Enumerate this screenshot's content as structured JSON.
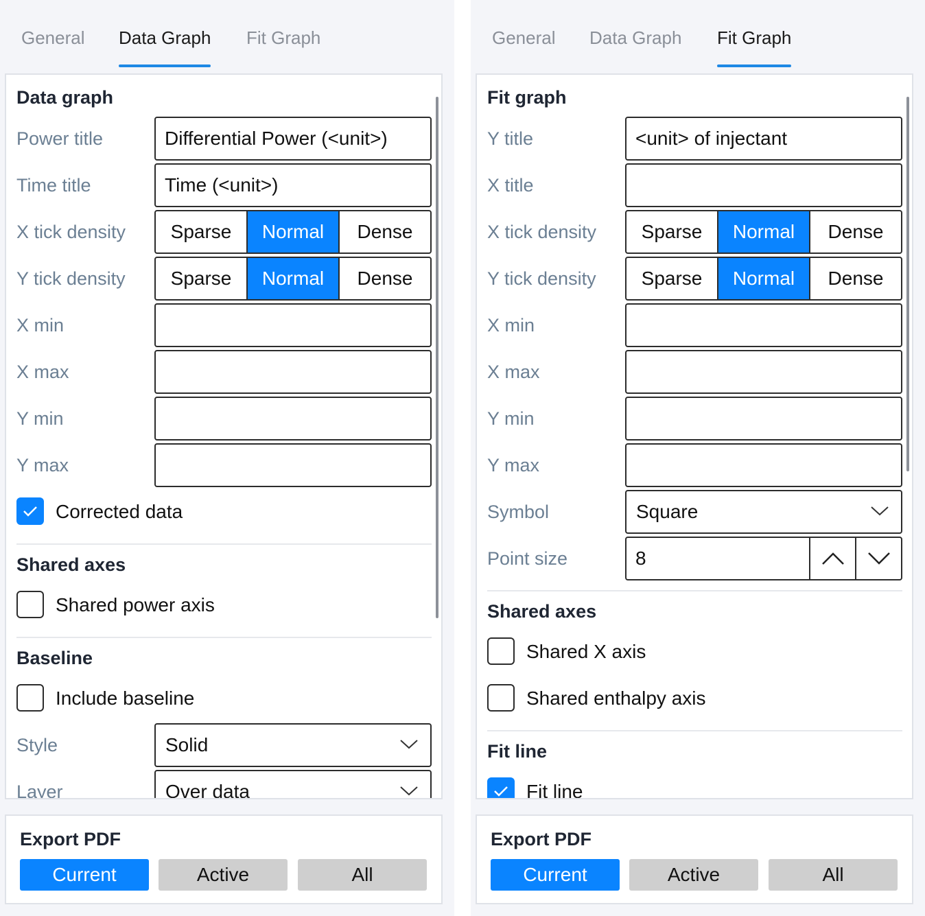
{
  "accent_color": "#0a84ff",
  "left": {
    "tabs": [
      {
        "label": "General"
      },
      {
        "label": "Data Graph"
      },
      {
        "label": "Fit Graph"
      }
    ],
    "active_tab": "Data Graph",
    "section_title": "Data graph",
    "power_title": {
      "label": "Power title",
      "value": "Differential Power (<unit>)"
    },
    "time_title": {
      "label": "Time title",
      "value": "Time (<unit>)"
    },
    "x_tick": {
      "label": "X tick density",
      "options": [
        "Sparse",
        "Normal",
        "Dense"
      ],
      "selected": "Normal"
    },
    "y_tick": {
      "label": "Y tick density",
      "options": [
        "Sparse",
        "Normal",
        "Dense"
      ],
      "selected": "Normal"
    },
    "x_min": {
      "label": "X min",
      "value": ""
    },
    "x_max": {
      "label": "X max",
      "value": ""
    },
    "y_min": {
      "label": "Y min",
      "value": ""
    },
    "y_max": {
      "label": "Y max",
      "value": ""
    },
    "corrected": {
      "label": "Corrected data",
      "checked": true
    },
    "shared_axes": {
      "title": "Shared axes",
      "power_axis": {
        "label": "Shared power axis",
        "checked": false
      }
    },
    "baseline": {
      "title": "Baseline",
      "include": {
        "label": "Include baseline",
        "checked": false
      },
      "style": {
        "label": "Style",
        "value": "Solid"
      },
      "layer": {
        "label": "Layer",
        "value": "Over data"
      }
    },
    "export": {
      "title": "Export PDF",
      "buttons": [
        "Current",
        "Active",
        "All"
      ],
      "selected": "Current"
    }
  },
  "right": {
    "tabs": [
      {
        "label": "General"
      },
      {
        "label": "Data Graph"
      },
      {
        "label": "Fit Graph"
      }
    ],
    "active_tab": "Fit Graph",
    "section_title": "Fit graph",
    "y_title": {
      "label": "Y title",
      "value": "<unit> of injectant"
    },
    "x_title": {
      "label": "X title",
      "value": ""
    },
    "x_tick": {
      "label": "X tick density",
      "options": [
        "Sparse",
        "Normal",
        "Dense"
      ],
      "selected": "Normal"
    },
    "y_tick": {
      "label": "Y tick density",
      "options": [
        "Sparse",
        "Normal",
        "Dense"
      ],
      "selected": "Normal"
    },
    "x_min": {
      "label": "X min",
      "value": ""
    },
    "x_max": {
      "label": "X max",
      "value": ""
    },
    "y_min": {
      "label": "Y min",
      "value": ""
    },
    "y_max": {
      "label": "Y max",
      "value": ""
    },
    "symbol": {
      "label": "Symbol",
      "value": "Square"
    },
    "point_size": {
      "label": "Point size",
      "value": "8"
    },
    "shared_axes": {
      "title": "Shared axes",
      "x_axis": {
        "label": "Shared X axis",
        "checked": false
      },
      "enthalpy_axis": {
        "label": "Shared enthalpy axis",
        "checked": false
      }
    },
    "fit_line": {
      "title": "Fit line",
      "toggle": {
        "label": "Fit line",
        "checked": true
      }
    },
    "export": {
      "title": "Export PDF",
      "buttons": [
        "Current",
        "Active",
        "All"
      ],
      "selected": "Current"
    }
  }
}
